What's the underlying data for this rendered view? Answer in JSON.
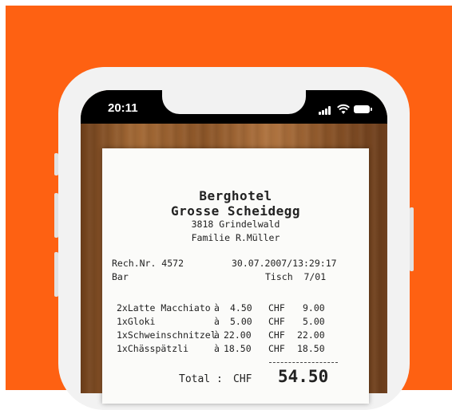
{
  "status_bar": {
    "time": "20:11"
  },
  "receipt": {
    "name_line1": "Berghotel",
    "name_line2": "Grosse Scheidegg",
    "address": "3818 Grindelwald",
    "family": "Familie R.Müller",
    "invoice_label": "Rech.Nr. 4572",
    "datetime": "30.07.2007/13:29:17",
    "area": "Bar",
    "table": "Tisch  7/01",
    "items": [
      {
        "desc": "2xLatte Macchiato",
        "at": "à",
        "unit": "4.50",
        "cur": "CHF",
        "amount": "9.00"
      },
      {
        "desc": "1xGloki",
        "at": "à",
        "unit": "5.00",
        "cur": "CHF",
        "amount": "5.00"
      },
      {
        "desc": "1xSchweinschnitzel",
        "at": "à",
        "unit": "22.00",
        "cur": "CHF",
        "amount": "22.00"
      },
      {
        "desc": "1xChässpätzli",
        "at": "à",
        "unit": "18.50",
        "cur": "CHF",
        "amount": "18.50"
      }
    ],
    "total_label": "Total :",
    "total_currency": "CHF",
    "total_value": "54.50"
  },
  "colors": {
    "background": "#fe6112",
    "phone_frame": "#f2f2f2",
    "receipt_paper": "#fbfbf9"
  }
}
